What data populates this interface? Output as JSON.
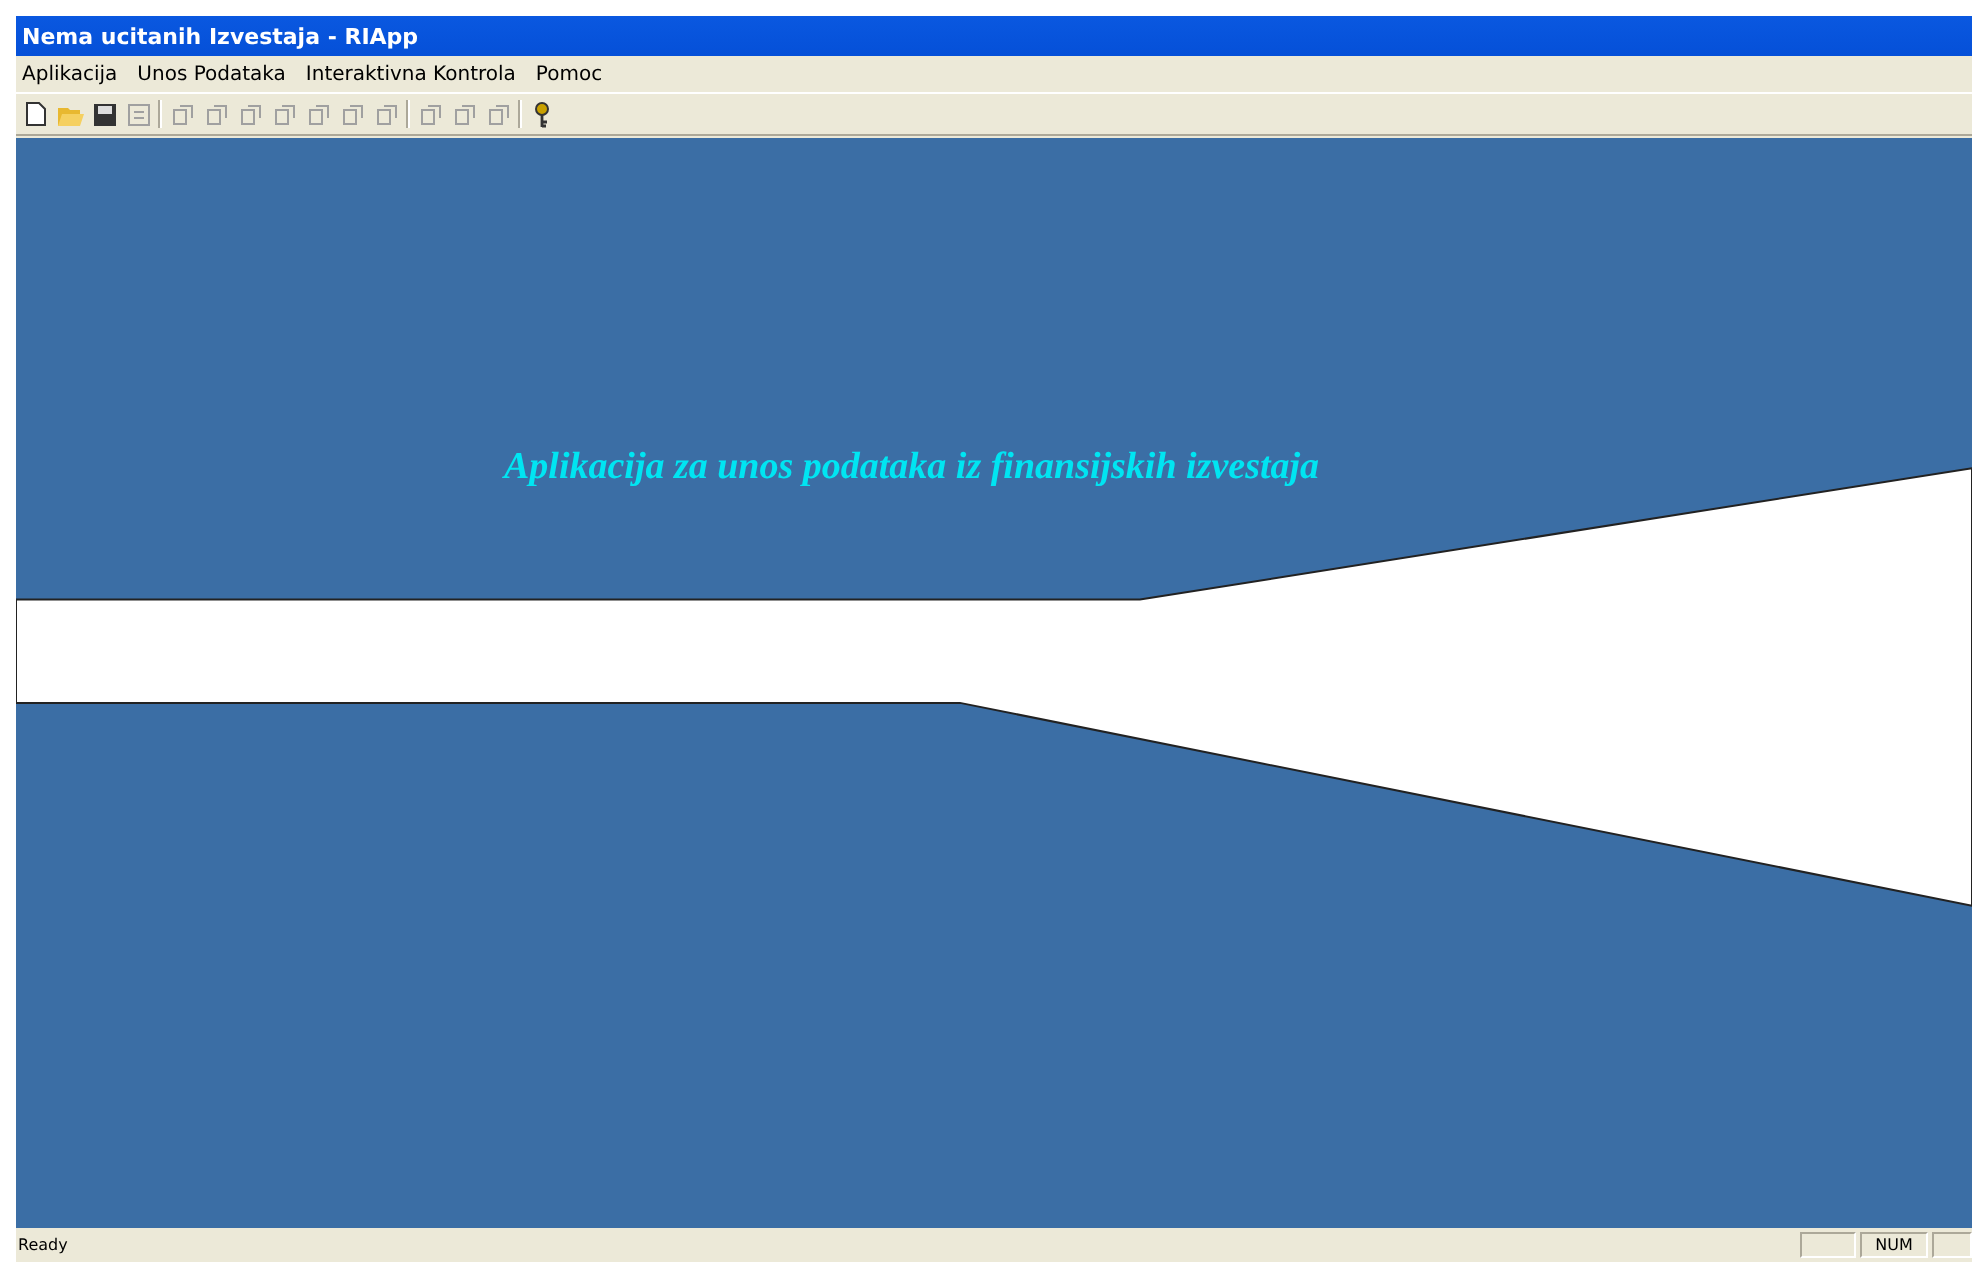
{
  "window": {
    "title": "Nema ucitanih Izvestaja - RIApp"
  },
  "menu": [
    "Aplikacija",
    "Unos Podataka",
    "Interaktivna Kontrola",
    "Pomoc"
  ],
  "toolbar": [
    {
      "kind": "new",
      "disabled": false
    },
    {
      "kind": "open",
      "disabled": false
    },
    {
      "kind": "save",
      "disabled": false
    },
    {
      "kind": "form",
      "disabled": true
    },
    {
      "kind": "sep"
    },
    {
      "kind": "doc",
      "disabled": true
    },
    {
      "kind": "doc",
      "disabled": true
    },
    {
      "kind": "doc",
      "disabled": true
    },
    {
      "kind": "doc",
      "disabled": true
    },
    {
      "kind": "doc",
      "disabled": true
    },
    {
      "kind": "doc",
      "disabled": true
    },
    {
      "kind": "doc",
      "disabled": true
    },
    {
      "kind": "sep"
    },
    {
      "kind": "doc",
      "disabled": true
    },
    {
      "kind": "doc",
      "disabled": true
    },
    {
      "kind": "doc",
      "disabled": true
    },
    {
      "kind": "sep"
    },
    {
      "kind": "key",
      "disabled": false
    }
  ],
  "main": {
    "heading": "Aplikacija za unos podataka iz finansijskih izvestaja"
  },
  "status_bar": {
    "text": "Ready",
    "panels": [
      "NUM"
    ]
  }
}
